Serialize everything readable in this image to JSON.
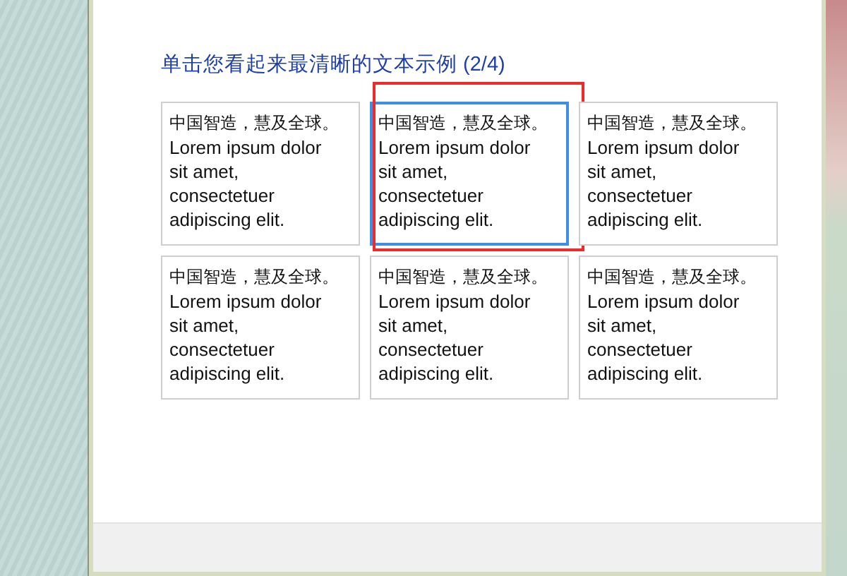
{
  "heading": "单击您看起来最清晰的文本示例 (2/4)",
  "samples": [
    {
      "lines": [
        "中国智造，慧及全球。",
        "Lorem ipsum dolor sit amet, consectetuer adipiscing elit."
      ],
      "selected": false
    },
    {
      "lines": [
        "中国智造，慧及全球。",
        "Lorem ipsum dolor sit amet, consectetuer adipiscing elit."
      ],
      "selected": true,
      "highlight": {
        "kind": "rectangle",
        "color": "#ee2a2a"
      }
    },
    {
      "lines": [
        "中国智造，慧及全球。",
        "Lorem ipsum dolor sit amet, consectetuer adipiscing elit."
      ],
      "selected": false
    },
    {
      "lines": [
        "中国智造，慧及全球。",
        "Lorem ipsum dolor sit amet, consectetuer adipiscing elit."
      ],
      "selected": false
    },
    {
      "lines": [
        "中国智造，慧及全球。",
        "Lorem ipsum dolor sit amet, consectetuer adipiscing elit."
      ],
      "selected": false
    },
    {
      "lines": [
        "中国智造，慧及全球。",
        "Lorem ipsum dolor sit amet, consectetuer adipiscing elit."
      ],
      "selected": false
    }
  ]
}
